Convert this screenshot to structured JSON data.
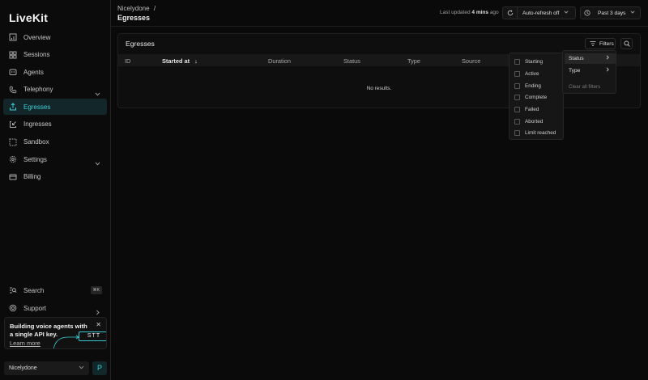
{
  "app": {
    "logo": "LiveKit"
  },
  "sidebar": {
    "items": [
      {
        "label": "Overview",
        "icon": "overview-icon"
      },
      {
        "label": "Sessions",
        "icon": "sessions-icon"
      },
      {
        "label": "Agents",
        "icon": "agents-icon"
      },
      {
        "label": "Telephony",
        "icon": "phone-icon"
      },
      {
        "label": "Egresses",
        "icon": "egress-icon",
        "active": true
      },
      {
        "label": "Ingresses",
        "icon": "ingress-icon"
      },
      {
        "label": "Sandbox",
        "icon": "sandbox-icon"
      },
      {
        "label": "Settings",
        "icon": "gear-icon"
      },
      {
        "label": "Billing",
        "icon": "billing-icon"
      }
    ],
    "search": {
      "label": "Search",
      "shortcut": "⌘K"
    },
    "support": {
      "label": "Support"
    },
    "promo": {
      "text": "Building voice agents with a single API key.",
      "link": "Learn more",
      "badge": "STT"
    },
    "workspace": {
      "name": "Nicelydone",
      "avatar": "P"
    }
  },
  "header": {
    "breadcrumb": "Nicelydone",
    "separator": "/",
    "title": "Egresses",
    "updated_prefix": "Last updated",
    "updated_value": "4 mins",
    "updated_suffix": "ago",
    "refresh_label": "Auto-refresh off",
    "range_label": "Past 3 days"
  },
  "panel": {
    "title": "Egresses",
    "filters_label": "Filters",
    "columns": [
      "ID",
      "Started at",
      "Duration",
      "Status",
      "Type",
      "Source"
    ],
    "empty": "No results."
  },
  "status_options": [
    "Starting",
    "Active",
    "Ending",
    "Complete",
    "Failed",
    "Aborted",
    "Limit reached"
  ],
  "filter_menu": {
    "items": [
      "Status",
      "Type"
    ],
    "clear": "Clear all filters"
  },
  "colors": {
    "accent": "#3ed0d9",
    "background": "#0a0a0a"
  }
}
